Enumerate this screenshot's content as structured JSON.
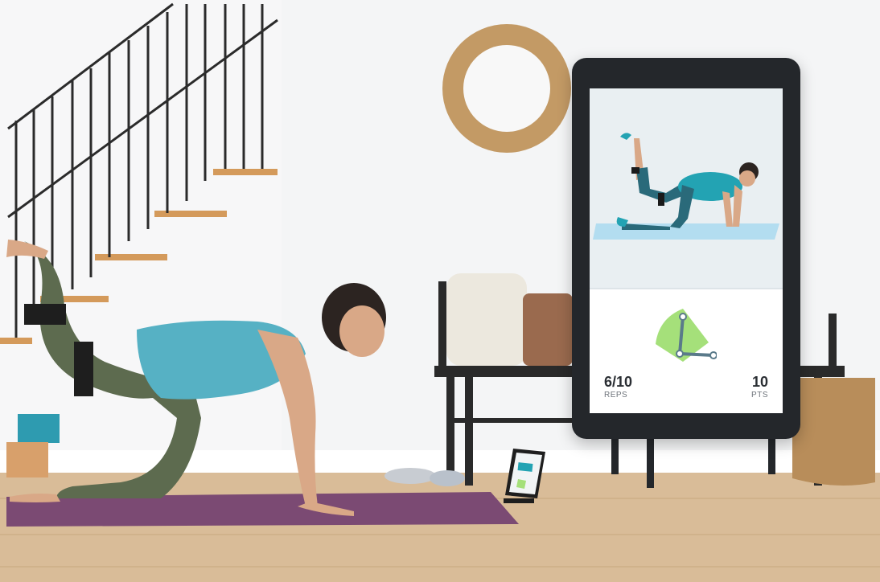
{
  "app": {
    "exercise_view": "exercise-illustration",
    "progress_indicator": "angle-gauge-icon"
  },
  "stats": {
    "reps_value": "6/10",
    "reps_label": "REPS",
    "points_value": "10",
    "points_label": "PTS"
  },
  "colors": {
    "accent_teal": "#23a3b3",
    "gauge_green": "#a5e07a",
    "gauge_stroke": "#5a7a8a",
    "mat_purple": "#7b4a73",
    "floor_wood": "#d7b995"
  }
}
